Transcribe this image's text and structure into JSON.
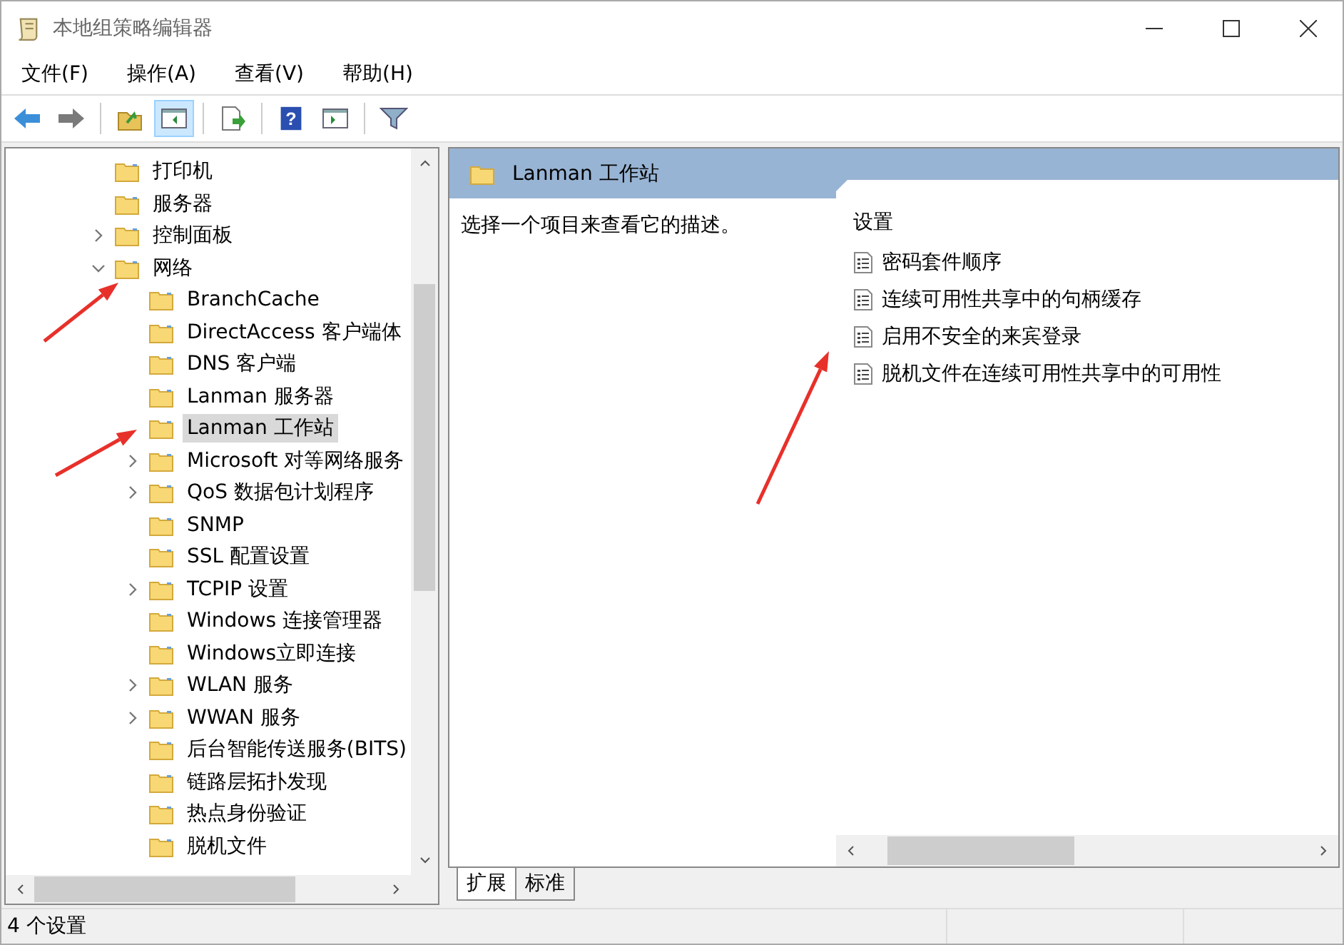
{
  "window": {
    "title": "本地组策略编辑器"
  },
  "menu": [
    "文件(F)",
    "操作(A)",
    "查看(V)",
    "帮助(H)"
  ],
  "toolbar": [
    {
      "kind": "back",
      "selected": false
    },
    {
      "kind": "forward",
      "selected": false
    },
    {
      "kind": "up",
      "selected": false
    },
    {
      "kind": "tree",
      "selected": true
    },
    {
      "kind": "export",
      "selected": false
    },
    {
      "kind": "help",
      "glyph": "?",
      "selected": false
    },
    {
      "kind": "pane",
      "selected": false
    },
    {
      "kind": "filter",
      "selected": false
    }
  ],
  "tree": [
    {
      "label": "打印机",
      "kind": "leaf",
      "selected": false
    },
    {
      "label": "服务器",
      "kind": "leaf",
      "selected": false
    },
    {
      "label": "控制面板",
      "kind": "branch",
      "expanded": false,
      "selected": false
    },
    {
      "label": "网络",
      "kind": "branch",
      "expanded": true,
      "selected": false,
      "children": [
        {
          "label": "BranchCache",
          "kind": "leaf",
          "selected": false
        },
        {
          "label": "DirectAccess 客户端体",
          "kind": "leaf",
          "selected": false
        },
        {
          "label": "DNS 客户端",
          "kind": "leaf",
          "selected": false
        },
        {
          "label": "Lanman 服务器",
          "kind": "leaf",
          "selected": false
        },
        {
          "label": "Lanman 工作站",
          "kind": "leaf",
          "selected": true
        },
        {
          "label": "Microsoft 对等网络服务",
          "kind": "branch",
          "expanded": false,
          "selected": false
        },
        {
          "label": "QoS 数据包计划程序",
          "kind": "branch",
          "expanded": false,
          "selected": false
        },
        {
          "label": "SNMP",
          "kind": "leaf",
          "selected": false
        },
        {
          "label": "SSL 配置设置",
          "kind": "leaf",
          "selected": false
        },
        {
          "label": "TCPIP 设置",
          "kind": "branch",
          "expanded": false,
          "selected": false
        },
        {
          "label": "Windows 连接管理器",
          "kind": "leaf",
          "selected": false
        },
        {
          "label": "Windows立即连接",
          "kind": "leaf",
          "selected": false
        },
        {
          "label": "WLAN 服务",
          "kind": "branch",
          "expanded": false,
          "selected": false
        },
        {
          "label": "WWAN 服务",
          "kind": "branch",
          "expanded": false,
          "selected": false
        },
        {
          "label": "后台智能传送服务(BITS)",
          "kind": "leaf",
          "selected": false
        },
        {
          "label": "链路层拓扑发现",
          "kind": "leaf",
          "selected": false
        },
        {
          "label": "热点身份验证",
          "kind": "leaf",
          "selected": false
        },
        {
          "label": "脱机文件",
          "kind": "leaf",
          "selected": false
        }
      ]
    }
  ],
  "details": {
    "title": "Lanman 工作站",
    "description": "选择一个项目来查看它的描述。",
    "column": "设置",
    "settings": [
      "密码套件顺序",
      "连续可用性共享中的句柄缓存",
      "启用不安全的来宾登录",
      "脱机文件在连续可用性共享中的可用性"
    ]
  },
  "view_tabs": [
    {
      "label": "扩展",
      "selected": true
    },
    {
      "label": "标准",
      "selected": false
    }
  ],
  "status_bar": "4 个设置"
}
